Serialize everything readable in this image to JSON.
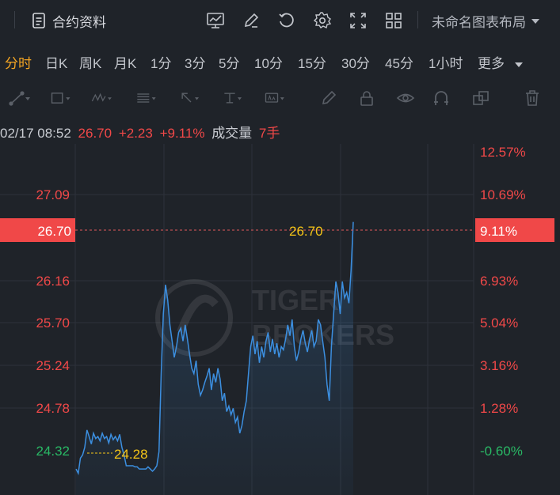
{
  "toolbar": {
    "doc_label": "合约资料",
    "layout_name": "未命名图表布局",
    "icons": [
      "indicator-icon",
      "edit-icon",
      "reset-icon",
      "settings-icon",
      "fullscreen-icon",
      "grid-layout-icon"
    ]
  },
  "periods": [
    {
      "label": "分时",
      "active": true
    },
    {
      "label": "日K"
    },
    {
      "label": "周K"
    },
    {
      "label": "月K"
    },
    {
      "label": "1分"
    },
    {
      "label": "3分"
    },
    {
      "label": "5分"
    },
    {
      "label": "10分"
    },
    {
      "label": "15分"
    },
    {
      "label": "30分"
    },
    {
      "label": "45分"
    },
    {
      "label": "1小时"
    },
    {
      "label": "更多"
    }
  ],
  "quote": {
    "time": "02/17 08:52",
    "price": "26.70",
    "change": "+2.23",
    "change_pct": "+9.11%",
    "volume_label": "成交量",
    "volume": "7手"
  },
  "colors": {
    "up": "#f04848",
    "down": "#29b865",
    "line": "#3c8fe0",
    "marker": "#f5c518",
    "bg": "#1f2329"
  },
  "watermark": {
    "line1": "TIGER",
    "line2": "BROKERS"
  },
  "chart_data": {
    "type": "line",
    "y_left_ticks": [
      "27.09",
      "26.16",
      "25.70",
      "25.24",
      "24.78",
      "24.32"
    ],
    "y_right_ticks": [
      "12.57%",
      "10.69%",
      "6.93%",
      "5.04%",
      "3.16%",
      "1.28%",
      "-0.60%"
    ],
    "current_price_label": "26.70",
    "current_pct_label": "9.11%",
    "high_label": "26.70",
    "low_label": "24.28",
    "ylim": [
      24.18,
      27.42
    ],
    "series": [
      {
        "values": [
          24.42,
          24.38,
          24.52,
          24.55,
          24.62,
          24.78,
          24.72,
          24.65,
          24.75,
          24.7,
          24.72,
          24.68,
          24.75,
          24.7,
          24.72,
          24.66,
          24.74,
          24.69,
          24.72,
          24.68,
          24.74,
          24.62,
          24.55,
          24.45,
          24.45,
          24.45,
          24.45,
          24.44,
          24.44,
          24.42,
          24.42,
          24.42,
          24.42,
          24.44,
          24.42,
          24.4,
          24.42,
          24.45,
          24.58,
          25.3,
          25.85,
          26.12,
          25.98,
          25.75,
          25.6,
          25.45,
          25.55,
          25.68,
          25.72,
          25.6,
          25.75,
          25.62,
          25.48,
          25.35,
          25.3,
          25.42,
          25.2,
          25.1,
          25.15,
          25.22,
          25.28,
          25.35,
          25.15,
          25.3,
          25.22,
          25.35,
          25.25,
          25.05,
          25.12,
          24.95,
          25.0,
          24.92,
          24.98,
          24.85,
          24.9,
          24.75,
          24.82,
          24.95,
          25.05,
          25.3,
          25.55,
          25.65,
          25.48,
          25.6,
          25.4,
          25.55,
          25.45,
          25.6,
          25.68,
          25.5,
          25.62,
          25.48,
          25.58,
          25.45,
          25.55,
          25.52,
          25.62,
          25.75,
          25.65,
          25.8,
          25.55,
          25.42,
          25.5,
          25.62,
          25.7,
          25.58,
          25.5,
          25.62,
          25.7,
          25.55,
          25.6,
          25.8,
          25.75,
          25.6,
          25.45,
          25.2,
          25.05,
          25.55,
          25.85,
          26.15,
          26.05,
          25.85,
          26.15,
          26.0,
          26.05,
          25.95,
          26.25,
          26.7
        ]
      }
    ]
  }
}
